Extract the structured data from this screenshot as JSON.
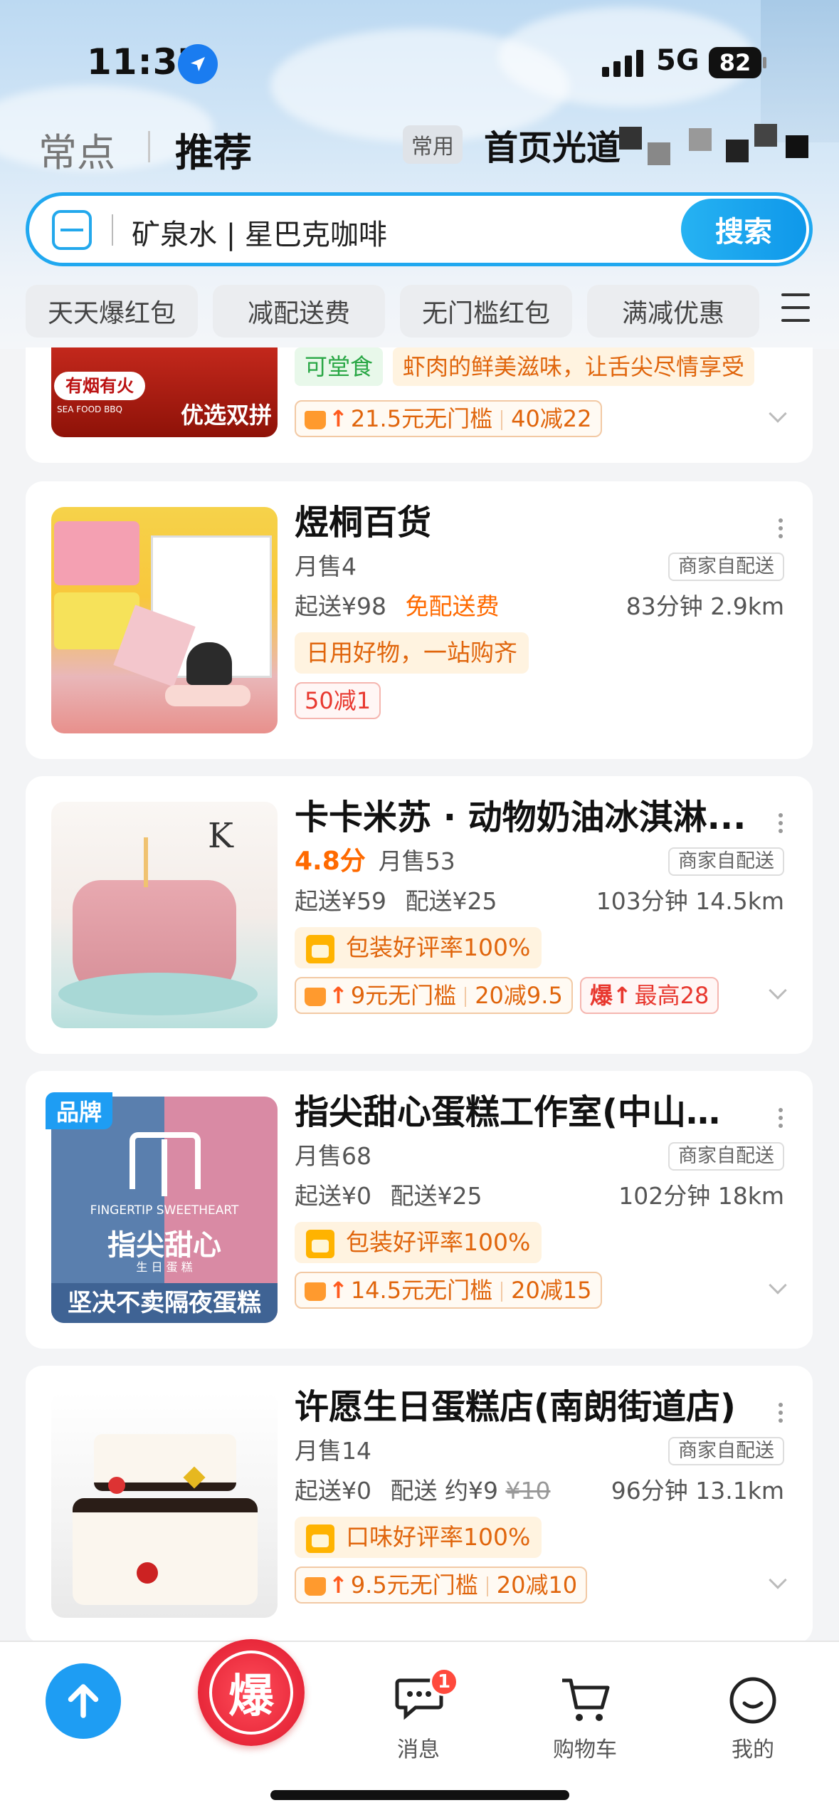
{
  "status": {
    "time": "11:37",
    "network": "5G",
    "battery": "82"
  },
  "header": {
    "tab_inactive": "常点",
    "tab_active": "推荐",
    "tag": "常用",
    "address": "首页光道"
  },
  "search": {
    "text": "矿泉水 | 星巴克咖啡",
    "button": "搜索"
  },
  "filters": [
    "天天爆红包",
    "减配送费",
    "无门槛红包",
    "满减优惠"
  ],
  "partial": {
    "tags": [
      "可堂食",
      "虾肉的鲜美滋味，让舌尖尽情享受"
    ],
    "thumb_text1": "有烟有火",
    "thumb_text2": "优选双拼",
    "thumb_text3": "SEA FOOD BBQ",
    "coupon_main": "21.5元无门槛",
    "coupon_sub": "40减22"
  },
  "stores": [
    {
      "name": "煜桐百货",
      "rating": "",
      "sales": "月售4",
      "delivery_type": "商家自配送",
      "min_order": "起送¥98",
      "fee": "免配送费",
      "fee_old": "",
      "time_dist": "83分钟 2.9km",
      "highlight": "日用好物，一站购齐",
      "coupons": [
        {
          "kind": "plain",
          "text": "50减1"
        }
      ]
    },
    {
      "name": "卡卡米苏 · 动物奶油冰淇淋...",
      "rating": "4.8分",
      "sales": "月售53",
      "delivery_type": "商家自配送",
      "min_order": "起送¥59",
      "fee": "配送¥25",
      "fee_old": "",
      "time_dist": "103分钟 14.5km",
      "highlight": "包装好评率100%",
      "coupons": [
        {
          "kind": "crown",
          "main": "9元无门槛",
          "sub": "20减9.5"
        },
        {
          "kind": "bao",
          "prefix": "爆",
          "main": "最高28"
        }
      ]
    },
    {
      "name": "指尖甜心蛋糕工作室(中山总...",
      "rating": "",
      "brand": "品牌",
      "sales": "月售68",
      "delivery_type": "商家自配送",
      "min_order": "起送¥0",
      "fee": "配送¥25",
      "fee_old": "",
      "time_dist": "102分钟 18km",
      "highlight": "包装好评率100%",
      "thumb_en": "FINGERTIP SWEETHEART",
      "thumb_cn": "指尖甜心",
      "thumb_sub": "生 日 蛋 糕",
      "thumb_banner": "坚决不卖隔夜蛋糕",
      "coupons": [
        {
          "kind": "crown",
          "main": "14.5元无门槛",
          "sub": "20减15"
        }
      ]
    },
    {
      "name": "许愿生日蛋糕店(南朗街道店)",
      "rating": "",
      "sales": "月售14",
      "delivery_type": "商家自配送",
      "min_order": "起送¥0",
      "fee": "配送 约¥9",
      "fee_old": "¥10",
      "time_dist": "96分钟 13.1km",
      "highlight": "口味好评率100%",
      "coupons": [
        {
          "kind": "crown",
          "main": "9.5元无门槛",
          "sub": "20减10"
        }
      ]
    }
  ],
  "tabbar": {
    "bao": "爆",
    "messages": "消息",
    "messages_badge": "1",
    "cart": "购物车",
    "mine": "我的"
  },
  "colors": {
    "accent": "#1e9df3",
    "orange": "#ff6a00",
    "red": "#e8283a"
  }
}
